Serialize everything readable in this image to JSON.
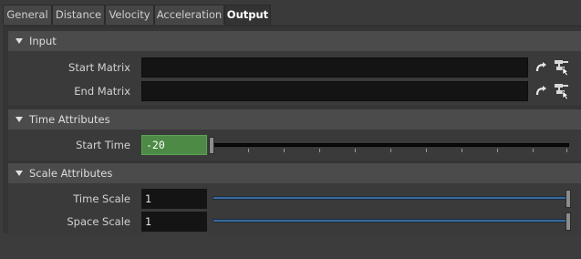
{
  "tabs": [
    "General",
    "Distance",
    "Velocity",
    "Acceleration",
    "Output"
  ],
  "active_tab": "Output",
  "sections": {
    "input": {
      "title": "Input",
      "start_matrix_label": "Start Matrix",
      "start_matrix_value": "",
      "end_matrix_label": "End Matrix",
      "end_matrix_value": ""
    },
    "time": {
      "title": "Time Attributes",
      "start_time_label": "Start Time",
      "start_time_value": "-20"
    },
    "scale": {
      "title": "Scale Attributes",
      "time_scale_label": "Time Scale",
      "time_scale_value": "1",
      "space_scale_label": "Space Scale",
      "space_scale_value": "1"
    }
  },
  "icons": [
    "expand-arrow-icon",
    "select-node-icon"
  ],
  "colors": {
    "start_time_field": "#4c8a45",
    "scale_slider": "#3b6a9a"
  }
}
